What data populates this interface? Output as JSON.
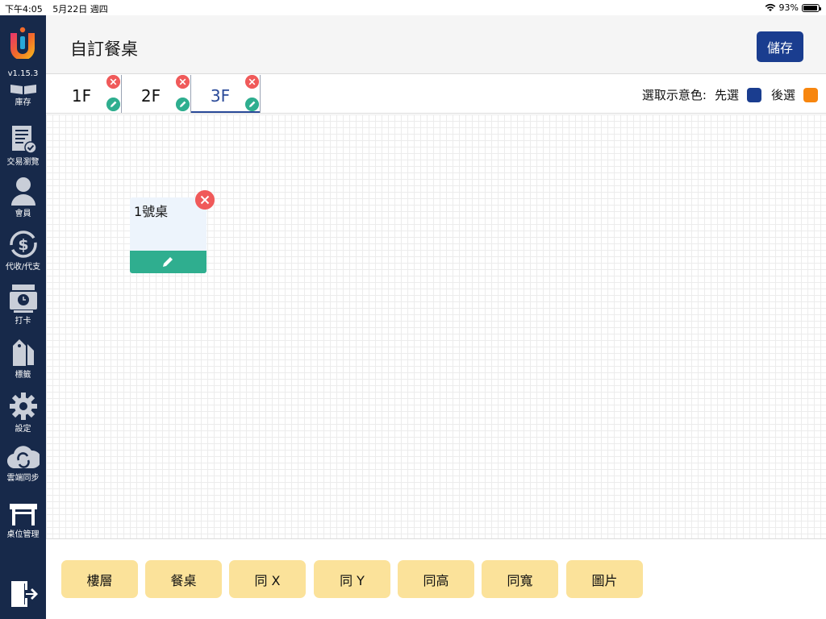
{
  "status": {
    "time": "下午4:05",
    "date": "5月22日 週四",
    "battery": "93%",
    "battery_level": 0.93
  },
  "sidebar": {
    "version": "v1.15.3",
    "items": [
      {
        "label": "庫存",
        "icon": "book-icon"
      },
      {
        "label": "交易瀏覽",
        "icon": "receipt-icon"
      },
      {
        "label": "會員",
        "icon": "person-icon"
      },
      {
        "label": "代收/代支",
        "icon": "dollar-cycle-icon"
      },
      {
        "label": "打卡",
        "icon": "clock-machine-icon"
      },
      {
        "label": "標籤",
        "icon": "tag-icon"
      },
      {
        "label": "設定",
        "icon": "gear-icon"
      },
      {
        "label": "雲端同步",
        "icon": "cloud-sync-icon"
      },
      {
        "label": "桌位管理",
        "icon": "table-icon"
      }
    ]
  },
  "header": {
    "title": "自訂餐桌",
    "save_label": "儲存"
  },
  "floors": [
    {
      "name": "1F"
    },
    {
      "name": "2F"
    },
    {
      "name": "3F",
      "active": true
    }
  ],
  "legend": {
    "label": "選取示意色:",
    "primary_label": "先選",
    "primary_color": "#1a3d8f",
    "secondary_label": "後選",
    "secondary_color": "#f7860f"
  },
  "tables": [
    {
      "name": "1號桌"
    }
  ],
  "toolbar": [
    {
      "label": "樓層"
    },
    {
      "label": "餐桌"
    },
    {
      "label": "同 X"
    },
    {
      "label": "同 Y"
    },
    {
      "label": "同高"
    },
    {
      "label": "同寬"
    },
    {
      "label": "圖片"
    }
  ],
  "colors": {
    "sidebar": "#17294a",
    "accent": "#1a3d8f",
    "delete": "#f05a5a",
    "edit": "#2fae8f",
    "tool_button": "#fbe29a"
  }
}
